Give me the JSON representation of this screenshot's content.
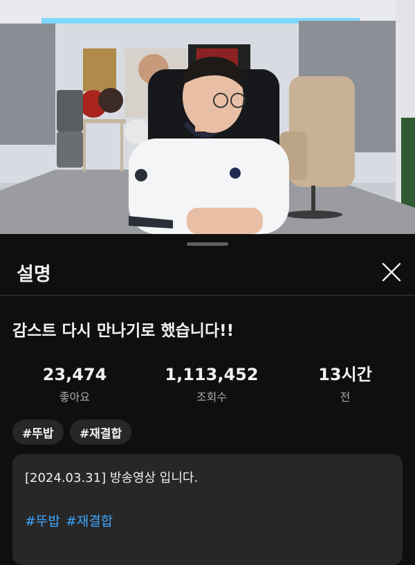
{
  "video": {
    "description": "Streamer in white football jersey sitting in gaming chair in a studio"
  },
  "sheet": {
    "header_title": "설명",
    "close_icon": "close-icon",
    "video_title": "감스트 다시 만나기로 했습니다!!",
    "stats": [
      {
        "value": "23,474",
        "label": "좋아요"
      },
      {
        "value": "1,113,452",
        "label": "조회수"
      },
      {
        "value": "13시간",
        "label": "전"
      }
    ],
    "chips": [
      "#뚜밥",
      "#재결합"
    ],
    "description": {
      "line1": "[2024.03.31] 방송영상 입니다.",
      "tags": [
        "#뚜밥",
        "#재결합"
      ]
    }
  },
  "colors": {
    "background": "#0f0f0f",
    "chip_bg": "#272727",
    "link": "#3ea6ff"
  }
}
